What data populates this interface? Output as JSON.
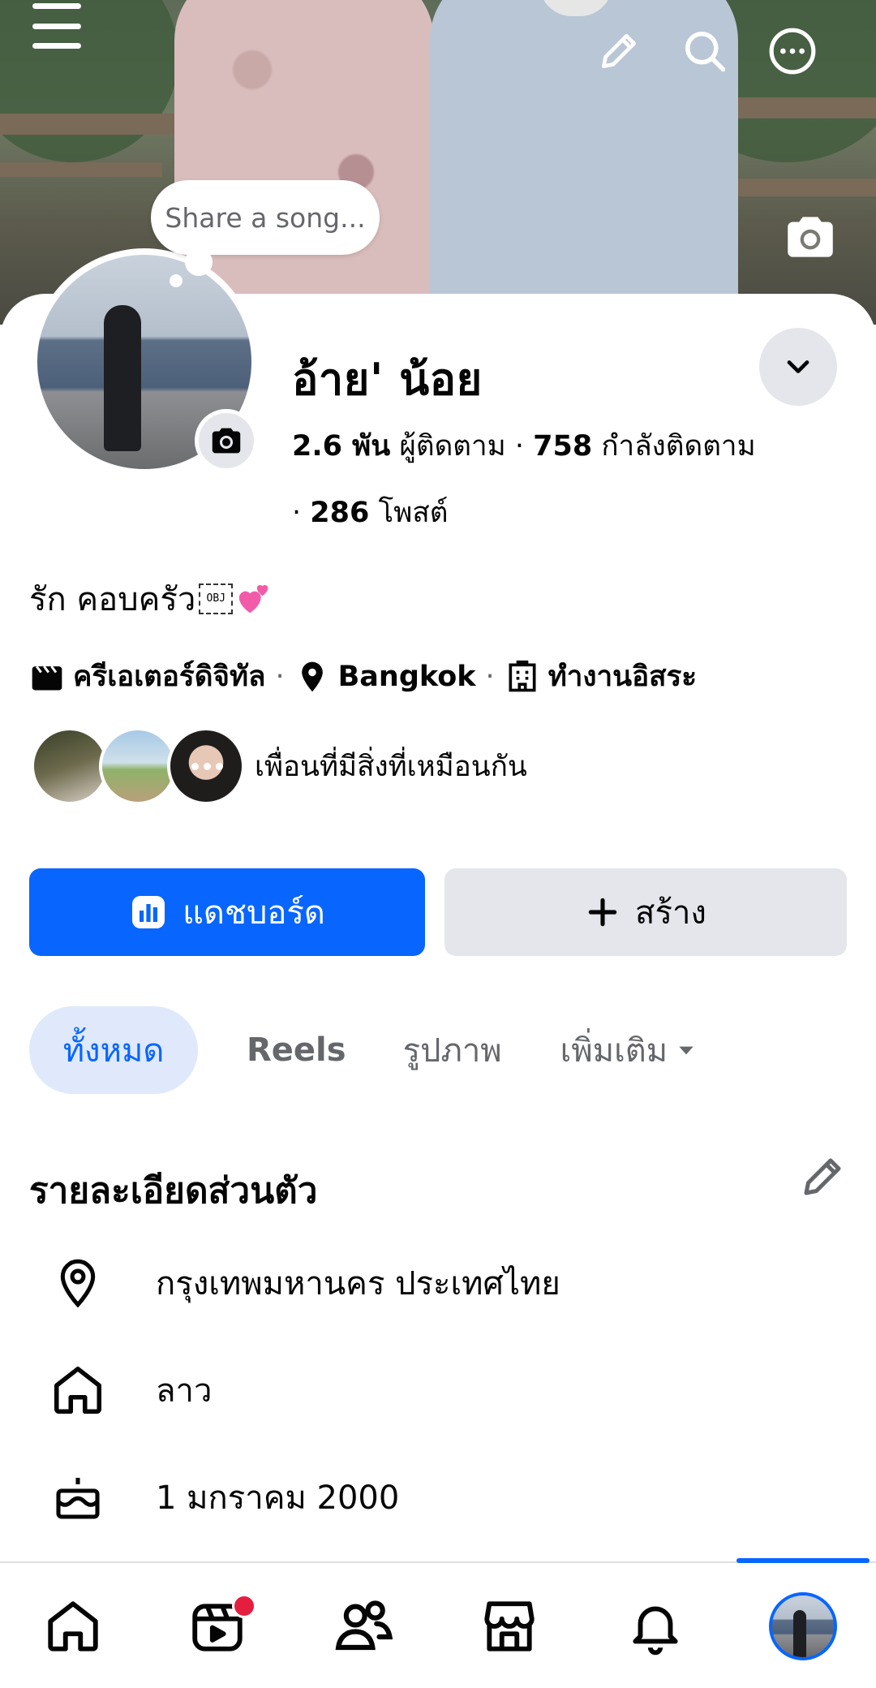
{
  "cover": {
    "song_prompt": "Share a song..."
  },
  "profile": {
    "name": "อ้าย' น้อย",
    "followers_count": "2.6 พัน",
    "followers_label": "ผู้ติดตาม",
    "following_count": "758",
    "following_label": "กำลังติดตาม",
    "posts_count": "286",
    "posts_label": "โพสต์",
    "bio": "รัก คอบครัว",
    "bio_placeholder_glyph": "OBJ",
    "creator_label": "ครีเอเตอร์ดิจิทัล",
    "location_label": "Bangkok",
    "work_label": "ทำงานอิสระ",
    "mutual_friends_text": "เพื่อนที่มีสิ่งที่เหมือนกัน"
  },
  "actions": {
    "dashboard_label": "แดชบอร์ด",
    "create_label": "สร้าง"
  },
  "tabs": [
    {
      "label": "ทั้งหมด",
      "active": true
    },
    {
      "label": "Reels",
      "active": false
    },
    {
      "label": "รูปภาพ",
      "active": false
    },
    {
      "label": "เพิ่มเติม",
      "active": false
    }
  ],
  "details": {
    "title": "รายละเอียดส่วนตัว",
    "items": [
      {
        "icon": "location-pin-icon",
        "text": "กรุงเทพมหานคร ประเทศไทย"
      },
      {
        "icon": "home-icon",
        "text": "ลาว"
      },
      {
        "icon": "birthday-cake-icon",
        "text": "1 มกราคม  2000"
      }
    ]
  },
  "nav": {
    "items": [
      "home-icon",
      "reels-icon",
      "friends-icon",
      "marketplace-icon",
      "notifications-icon",
      "profile-avatar"
    ],
    "active": "profile-avatar",
    "reels_badge": true
  },
  "colors": {
    "accent": "#0866ff",
    "secondary_button": "#e4e6eb",
    "text_secondary": "#65676b",
    "badge": "#e41e3f"
  }
}
